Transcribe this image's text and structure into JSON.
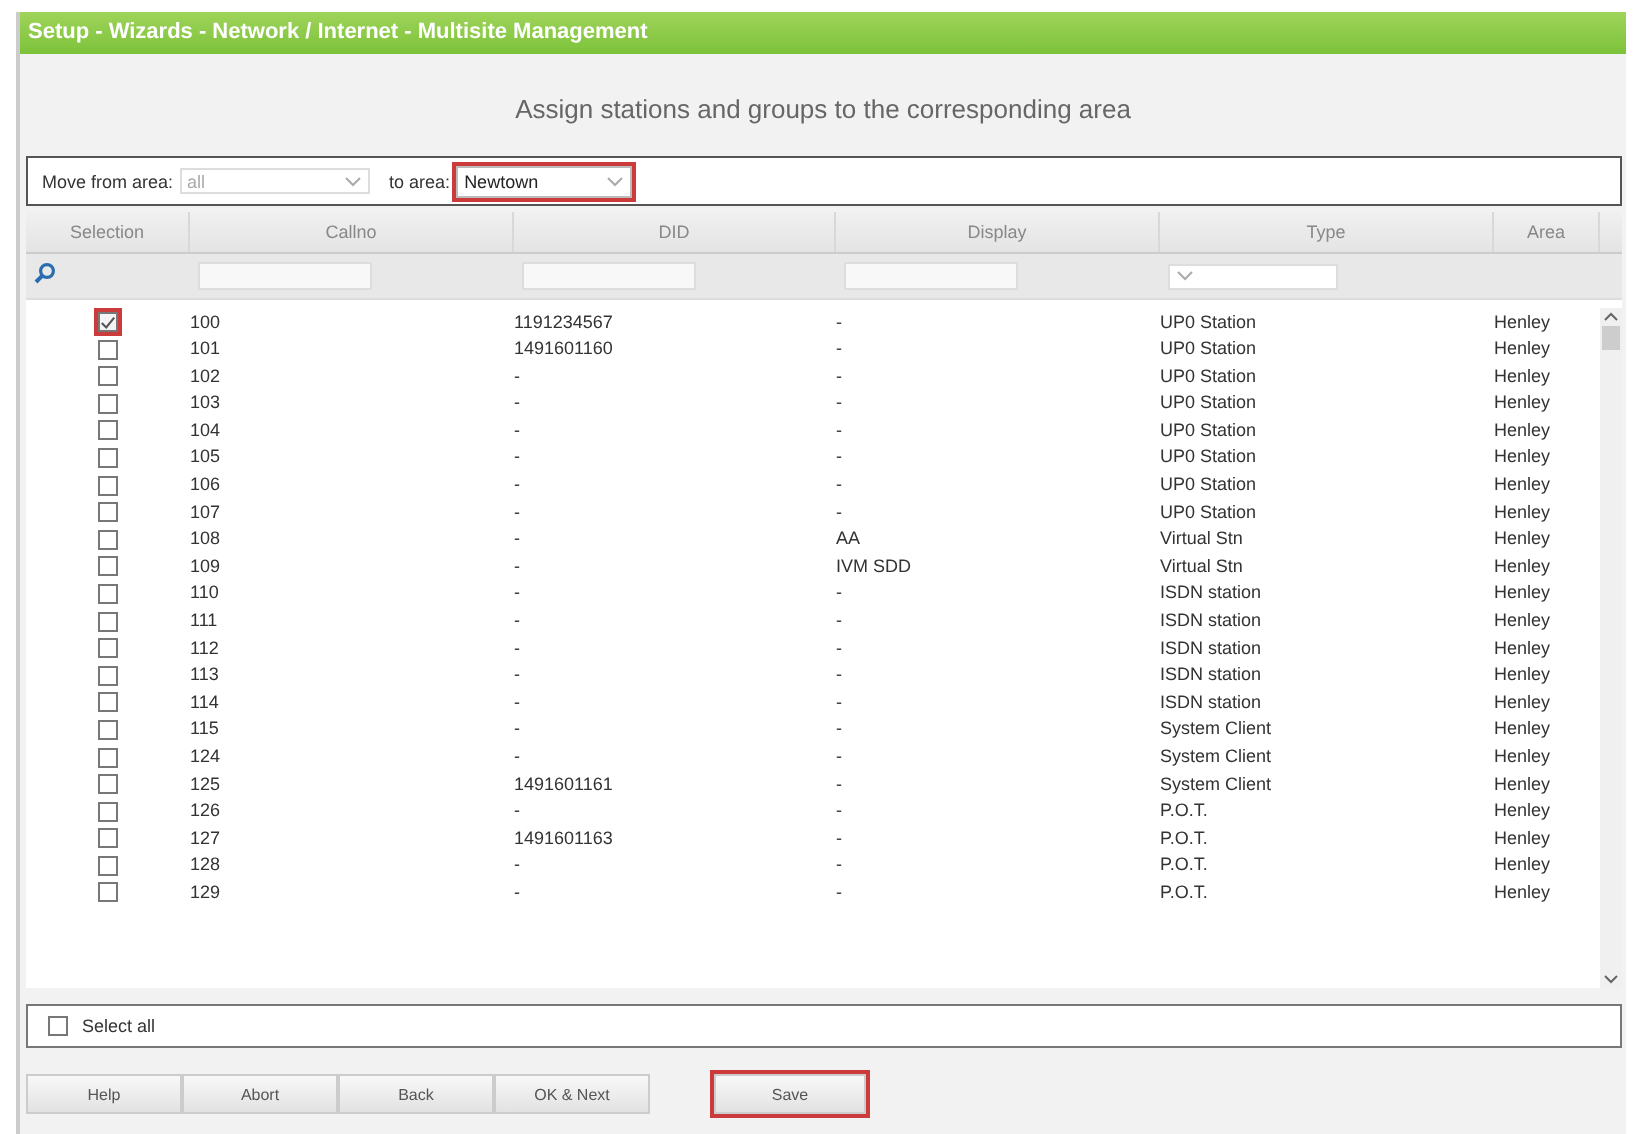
{
  "window": {
    "title": "Setup - Wizards - Network / Internet - Multisite Management"
  },
  "heading": "Assign stations and groups to the corresponding area",
  "filter": {
    "from_label": "Move from area:",
    "from_value": "all",
    "from_disabled": true,
    "to_label": "to area:",
    "to_value": "Newtown",
    "to_highlighted": true
  },
  "table": {
    "columns": [
      "Selection",
      "Callno",
      "DID",
      "Display",
      "Type",
      "Area"
    ],
    "rows": [
      {
        "checked": true,
        "highlighted": true,
        "callno": "100",
        "did": "1191234567",
        "display": "-",
        "type": "UP0 Station",
        "area": "Henley"
      },
      {
        "checked": false,
        "highlighted": false,
        "callno": "101",
        "did": "1491601160",
        "display": "-",
        "type": "UP0 Station",
        "area": "Henley"
      },
      {
        "checked": false,
        "highlighted": false,
        "callno": "102",
        "did": "-",
        "display": "-",
        "type": "UP0 Station",
        "area": "Henley"
      },
      {
        "checked": false,
        "highlighted": false,
        "callno": "103",
        "did": "-",
        "display": "-",
        "type": "UP0 Station",
        "area": "Henley"
      },
      {
        "checked": false,
        "highlighted": false,
        "callno": "104",
        "did": "-",
        "display": "-",
        "type": "UP0 Station",
        "area": "Henley"
      },
      {
        "checked": false,
        "highlighted": false,
        "callno": "105",
        "did": "-",
        "display": "-",
        "type": "UP0 Station",
        "area": "Henley"
      },
      {
        "checked": false,
        "highlighted": false,
        "callno": "106",
        "did": "-",
        "display": "-",
        "type": "UP0 Station",
        "area": "Henley"
      },
      {
        "checked": false,
        "highlighted": false,
        "callno": "107",
        "did": "-",
        "display": "-",
        "type": "UP0 Station",
        "area": "Henley"
      },
      {
        "checked": false,
        "highlighted": false,
        "callno": "108",
        "did": "-",
        "display": "AA",
        "type": "Virtual Stn",
        "area": "Henley"
      },
      {
        "checked": false,
        "highlighted": false,
        "callno": "109",
        "did": "-",
        "display": "IVM SDD",
        "type": "Virtual Stn",
        "area": "Henley"
      },
      {
        "checked": false,
        "highlighted": false,
        "callno": "110",
        "did": "-",
        "display": "-",
        "type": "ISDN station",
        "area": "Henley"
      },
      {
        "checked": false,
        "highlighted": false,
        "callno": "111",
        "did": "-",
        "display": "-",
        "type": "ISDN station",
        "area": "Henley"
      },
      {
        "checked": false,
        "highlighted": false,
        "callno": "112",
        "did": "-",
        "display": "-",
        "type": "ISDN station",
        "area": "Henley"
      },
      {
        "checked": false,
        "highlighted": false,
        "callno": "113",
        "did": "-",
        "display": "-",
        "type": "ISDN station",
        "area": "Henley"
      },
      {
        "checked": false,
        "highlighted": false,
        "callno": "114",
        "did": "-",
        "display": "-",
        "type": "ISDN station",
        "area": "Henley"
      },
      {
        "checked": false,
        "highlighted": false,
        "callno": "115",
        "did": "-",
        "display": "-",
        "type": "System Client",
        "area": "Henley"
      },
      {
        "checked": false,
        "highlighted": false,
        "callno": "124",
        "did": "-",
        "display": "-",
        "type": "System Client",
        "area": "Henley"
      },
      {
        "checked": false,
        "highlighted": false,
        "callno": "125",
        "did": "1491601161",
        "display": "-",
        "type": "System Client",
        "area": "Henley"
      },
      {
        "checked": false,
        "highlighted": false,
        "callno": "126",
        "did": "-",
        "display": "-",
        "type": "P.O.T.",
        "area": "Henley"
      },
      {
        "checked": false,
        "highlighted": false,
        "callno": "127",
        "did": "1491601163",
        "display": "-",
        "type": "P.O.T.",
        "area": "Henley"
      },
      {
        "checked": false,
        "highlighted": false,
        "callno": "128",
        "did": "-",
        "display": "-",
        "type": "P.O.T.",
        "area": "Henley"
      },
      {
        "checked": false,
        "highlighted": false,
        "callno": "129",
        "did": "-",
        "display": "-",
        "type": "P.O.T.",
        "area": "Henley"
      }
    ]
  },
  "select_all": {
    "label": "Select all",
    "checked": false
  },
  "buttons": [
    {
      "label": "Help",
      "highlighted": false
    },
    {
      "label": "Abort",
      "highlighted": false
    },
    {
      "label": "Back",
      "highlighted": false
    },
    {
      "label": "OK & Next",
      "highlighted": false
    },
    {
      "label": "Save",
      "highlighted": true
    }
  ]
}
